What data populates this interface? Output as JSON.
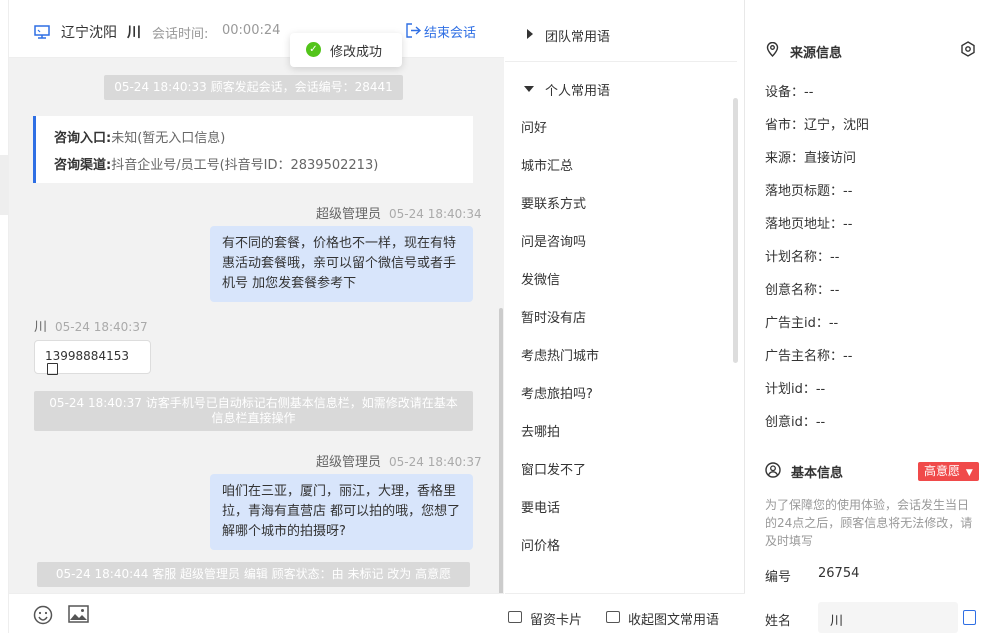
{
  "header": {
    "location": "辽宁沈阳",
    "visitor_name": "川",
    "session_time_label": "会话时间:",
    "session_time": "00:00:24",
    "end_session": "结束会话"
  },
  "toast": {
    "text": "修改成功"
  },
  "chat": {
    "system_start": "05-24 18:40:33 顾客发起会话，会话编号：28441",
    "entry_label": "咨询入口:",
    "entry_value": "未知(暂无入口信息)",
    "channel_label": "咨询渠道:",
    "channel_value": "抖音企业号/员工号(抖音号ID：2839502213)",
    "msg1_sender": "超级管理员",
    "msg1_time": "05-24 18:40:34",
    "msg1_text": "有不同的套餐，价格也不一样，现在有特惠活动套餐哦，亲可以留个微信号或者手机号 加您发套餐参考下",
    "msg2_sender": "川",
    "msg2_time": "05-24 18:40:37",
    "msg2_text": "13998884153",
    "system_phone": "05-24 18:40:37 访客手机号已自动标记右侧基本信息栏，如需修改请在基本信息栏直接操作",
    "msg3_sender": "超级管理员",
    "msg3_time": "05-24 18:40:37",
    "msg3_text": "咱们在三亚，厦门，丽江，大理，香格里拉，青海有直营店 都可以拍的哦，您想了解哪个城市的拍摄呀?",
    "system_status": "05-24 18:40:44 客服 超级管理员 编辑 顾客状态：由 未标记 改为 高意愿"
  },
  "phrases": {
    "team_group": "团队常用语",
    "personal_group": "个人常用语",
    "items": [
      "问好",
      "城市汇总",
      "要联系方式",
      "问是咨询吗",
      "发微信",
      "暂时没有店",
      "考虑热门城市",
      "考虑旅拍吗?",
      "去哪拍",
      "窗口发不了",
      "要电话",
      "问价格"
    ],
    "footer_card": "留资卡片",
    "footer_collapse": "收起图文常用语"
  },
  "source": {
    "title": "来源信息",
    "rows": [
      "设备：--",
      "省市：辽宁，沈阳",
      "来源：直接访问",
      "落地页标题：--",
      "落地页地址：--",
      "计划名称：--",
      "创意名称：--",
      "广告主id：--",
      "广告主名称：--",
      "计划id：--",
      "创意id：--"
    ]
  },
  "basic": {
    "title": "基本信息",
    "badge": "高意愿",
    "note": "为了保障您的使用体验，会话发生当日的24点之后，顾客信息将无法修改，请及时填写",
    "id_label": "编号",
    "id_value": "26754",
    "name_label": "姓名",
    "name_value": "川"
  },
  "colors": {
    "accent": "#2f6fe4",
    "badge": "#f04a4a",
    "bubble_out": "#d8e5fb",
    "success": "#52c41a"
  }
}
